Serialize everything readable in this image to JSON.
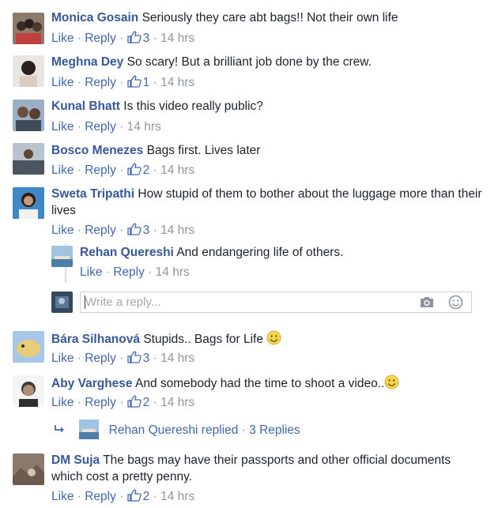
{
  "actions": {
    "like": "Like",
    "reply": "Reply",
    "sep": "·"
  },
  "comments": [
    {
      "name": "Monica Gosain",
      "text": "Seriously they care abt bags!! Not their own life",
      "likes": "3",
      "time": "14 hrs"
    },
    {
      "name": "Meghna Dey",
      "text": "So scary! But a brilliant job done by the crew.",
      "likes": "1",
      "time": "14 hrs"
    },
    {
      "name": "Kunal Bhatt",
      "text": "Is this video really public?",
      "likes": "",
      "time": "14 hrs"
    },
    {
      "name": "Bosco Menezes",
      "text": "Bags first. Lives later",
      "likes": "2",
      "time": "14 hrs"
    },
    {
      "name": "Sweta Tripathi",
      "text": "How stupid of them to bother about the luggage more than their lives",
      "likes": "3",
      "time": "14 hrs"
    },
    {
      "name": "Bára Silhanová",
      "text": "Stupids.. Bags for Life",
      "likes": "3",
      "time": "14 hrs"
    },
    {
      "name": "Aby Varghese",
      "text": "And somebody had the time to shoot a video..",
      "likes": "2",
      "time": "14 hrs"
    },
    {
      "name": "DM Suja",
      "text": "The bags may have their passports and other official documents which cost a pretty penny.",
      "likes": "2",
      "time": "14 hrs"
    }
  ],
  "reply": {
    "name": "Rehan Quereshi",
    "text": "And endangering life of others.",
    "time": "14 hrs"
  },
  "reply_box": {
    "placeholder": "Write a reply..."
  },
  "replies_summary": {
    "text": "Rehan Quereshi replied",
    "count": "3 Replies"
  },
  "colors": {
    "name": "#365899",
    "link": "#4267b2",
    "meta": "#90949c",
    "text": "#1d2129"
  }
}
